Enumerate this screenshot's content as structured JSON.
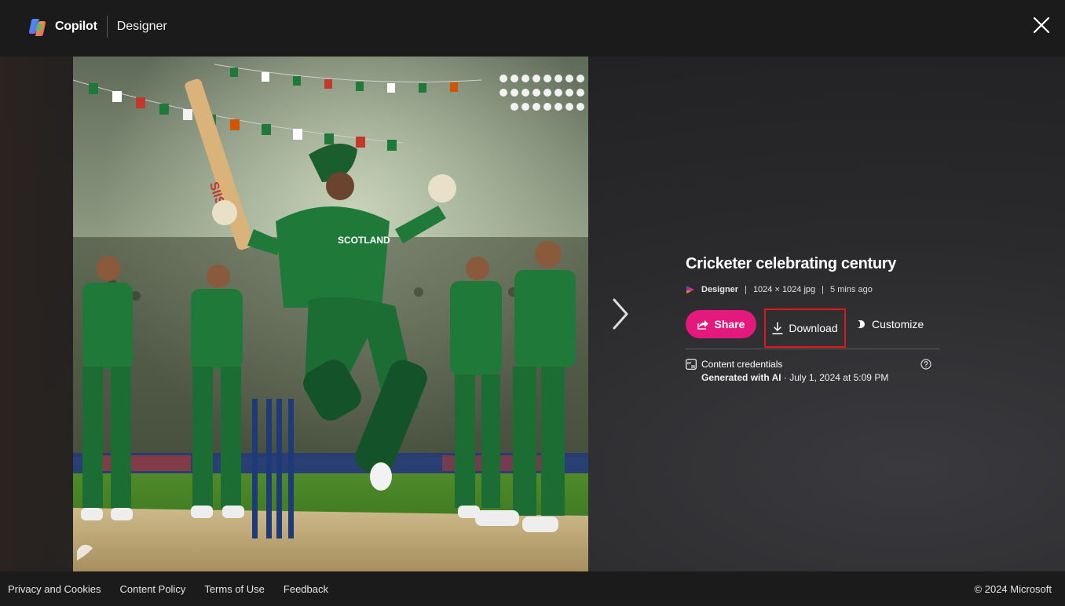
{
  "header": {
    "brand_name": "Copilot",
    "product_name": "Designer"
  },
  "image": {
    "jersey_text": "SCOTLAND",
    "bat_text": "SIIS"
  },
  "details": {
    "title": "Cricketer celebrating century",
    "app_name": "Designer",
    "file_info": "1024 × 1024 jpg",
    "time_ago": "5 mins ago",
    "separator": "|"
  },
  "actions": {
    "share_label": "Share",
    "download_label": "Download",
    "customize_label": "Customize"
  },
  "credentials": {
    "label": "Content credentials",
    "generated_label": "Generated with AI",
    "date_text": " · July 1, 2024 at 5:09 PM"
  },
  "footer": {
    "links": [
      "Privacy and Cookies",
      "Content Policy",
      "Terms of Use",
      "Feedback"
    ],
    "copyright": "© 2024 Microsoft"
  },
  "colors": {
    "share_button": "#e3197e",
    "highlight_border": "#e01818",
    "header_bg": "#1b1b1b",
    "jersey_green": "#1f7a3a"
  },
  "icons": [
    "copilot-logo-icon",
    "close-icon",
    "chevron-right-icon",
    "designer-icon",
    "share-icon",
    "download-icon",
    "customize-icon",
    "content-credentials-icon",
    "help-icon"
  ]
}
